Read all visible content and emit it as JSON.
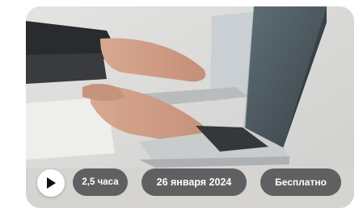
{
  "course_card": {
    "duration": "2,5 часа",
    "date": "26 января 2024",
    "price": "Бесплатно",
    "play_icon": "play-icon",
    "image_subject": "hands typing on laptop keyboards"
  },
  "colors": {
    "pill_bg": "#464648",
    "play_bg": "#ffffff",
    "play_icon": "#111111",
    "pill_text": "#ffffff"
  }
}
